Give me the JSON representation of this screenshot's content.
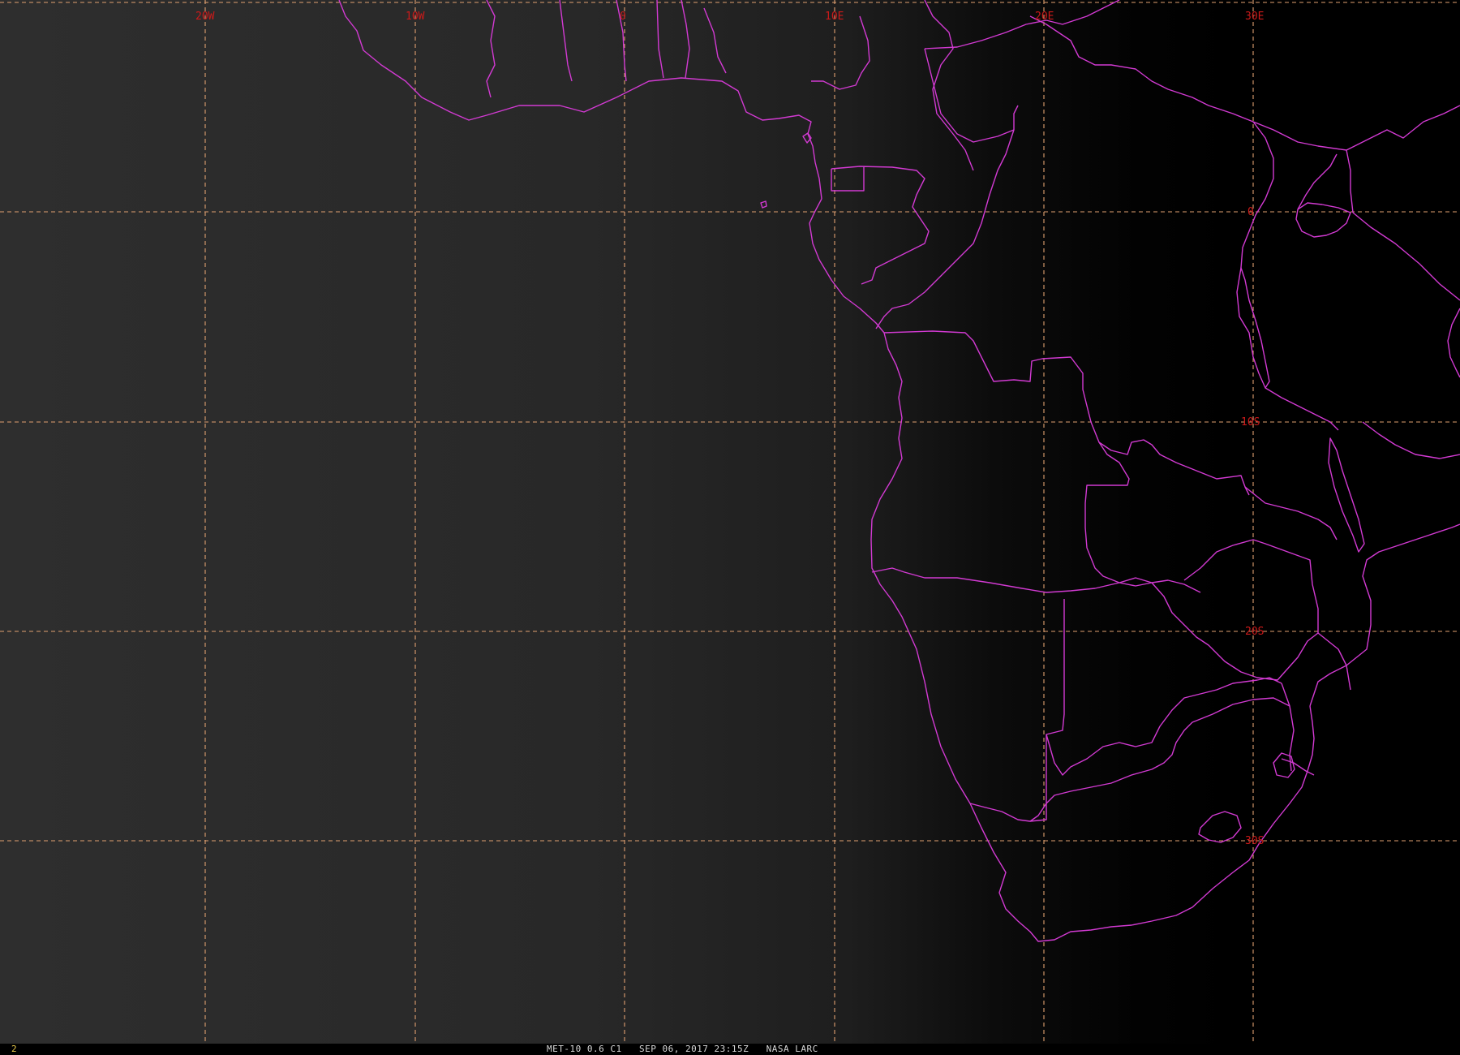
{
  "map": {
    "longitude_labels": [
      "20W",
      "10W",
      "0",
      "10E",
      "20E",
      "30E"
    ],
    "latitude_labels": [
      "0",
      "10S",
      "20S",
      "30S"
    ],
    "colors": {
      "grid": "#e0a070",
      "border": "#d23ad2",
      "label": "#cc1a1a"
    }
  },
  "status": {
    "frame_number": "2",
    "caption": "MET-10 0.6 C1   SEP 06, 2017 23:15Z   NASA LARC"
  }
}
